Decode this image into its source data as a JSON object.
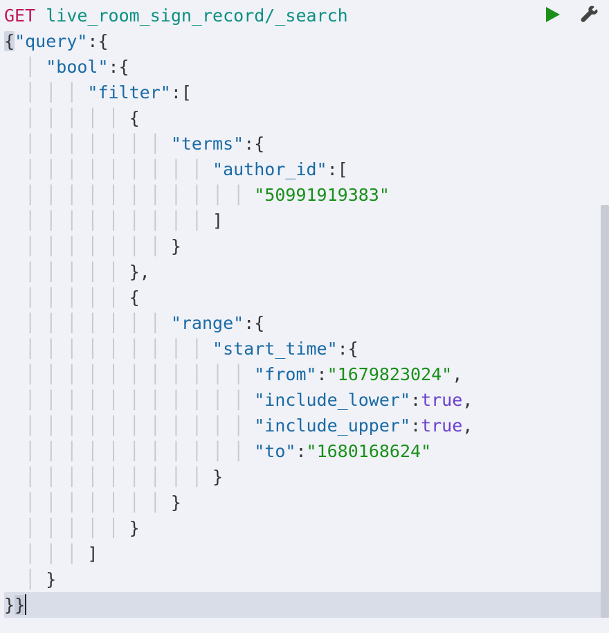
{
  "request": {
    "method": "GET",
    "path": "live_room_sign_record/_search"
  },
  "keys": {
    "query": "\"query\"",
    "bool": "\"bool\"",
    "filter": "\"filter\"",
    "terms": "\"terms\"",
    "author_id": "\"author_id\"",
    "range": "\"range\"",
    "start_time": "\"start_time\"",
    "from": "\"from\"",
    "include_lower": "\"include_lower\"",
    "include_upper": "\"include_upper\"",
    "to": "\"to\""
  },
  "values": {
    "author_id_0": "\"50991919383\"",
    "from": "\"1679823024\"",
    "to": "\"1680168624\"",
    "t": "true"
  },
  "punct": {
    "colon": ":",
    "comma": ",",
    "ob": "{",
    "cb": "}",
    "os": "[",
    "cs": "]",
    "cb_comma": "},"
  }
}
